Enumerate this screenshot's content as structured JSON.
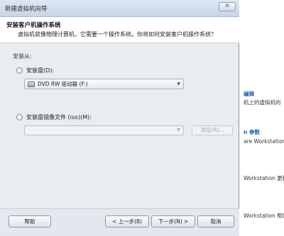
{
  "window": {
    "title": "新建虚拟机向导",
    "close_glyph": "✕"
  },
  "header": {
    "title": "安装客户机操作系统",
    "subtitle": "虚拟机就像物理计算机，它需要一个操作系统。你将如何安装客户机操作系统？"
  },
  "install_from": {
    "label": "安装从:",
    "disc_option": {
      "label": "安装盘(D):",
      "selected_drive": "DVD RW 驱动器 (F:)"
    },
    "iso_option": {
      "label": "安装盘镜像文件 (iso)(M):",
      "value": "",
      "browse_label": "浏览(R)..."
    }
  },
  "buttons": {
    "help": "帮助",
    "back": "< 上一步(B)",
    "next": "下一步(N) >",
    "cancel": "取消"
  },
  "background_app": {
    "lines": [
      "编辑",
      "机上的虚拟机的",
      "n 参数",
      "are Workstation 设",
      "Workstation 更新",
      "Workstation 帮助"
    ]
  }
}
